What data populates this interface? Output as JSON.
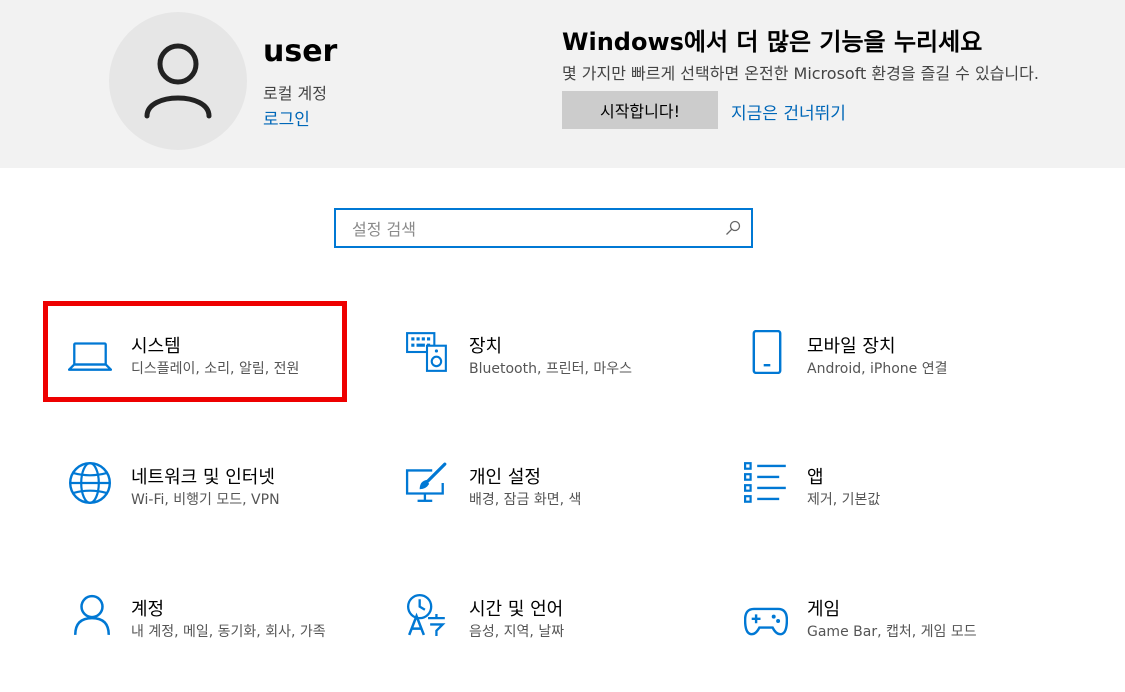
{
  "account": {
    "username": "user",
    "type": "로컬 계정",
    "login_link": "로그인"
  },
  "promo": {
    "title": "Windows에서 더 많은 기능을 누리세요",
    "description": "몇 가지만 빠르게 선택하면 온전한 Microsoft 환경을 즐길 수 있습니다.",
    "start_button": "시작합니다!",
    "skip_link": "지금은 건너뛰기"
  },
  "search": {
    "placeholder": "설정 검색"
  },
  "categories": [
    {
      "id": "system",
      "title": "시스템",
      "description": "디스플레이, 소리, 알림, 전원",
      "icon": "laptop-icon",
      "highlighted": true
    },
    {
      "id": "devices",
      "title": "장치",
      "description": "Bluetooth, 프린터, 마우스",
      "icon": "keyboard-speaker-icon"
    },
    {
      "id": "phone",
      "title": "모바일 장치",
      "description": "Android, iPhone 연결",
      "icon": "mobile-phone-icon"
    },
    {
      "id": "network",
      "title": "네트워크 및 인터넷",
      "description": "Wi-Fi, 비행기 모드, VPN",
      "icon": "globe-icon"
    },
    {
      "id": "personalization",
      "title": "개인 설정",
      "description": "배경, 잠금 화면, 색",
      "icon": "paintbrush-monitor-icon"
    },
    {
      "id": "apps",
      "title": "앱",
      "description": "제거, 기본값",
      "icon": "apps-list-icon"
    },
    {
      "id": "accounts",
      "title": "계정",
      "description": "내 계정, 메일, 동기화, 회사, 가족",
      "icon": "person-icon"
    },
    {
      "id": "time-language",
      "title": "시간 및 언어",
      "description": "음성, 지역, 날짜",
      "icon": "time-language-icon"
    },
    {
      "id": "gaming",
      "title": "게임",
      "description": "Game Bar, 캡처, 게임 모드",
      "icon": "gamepad-icon"
    }
  ],
  "colors": {
    "accent": "#0078d4",
    "link": "#0067b8",
    "highlight": "#ee0000",
    "header_bg": "#f2f2f2"
  }
}
